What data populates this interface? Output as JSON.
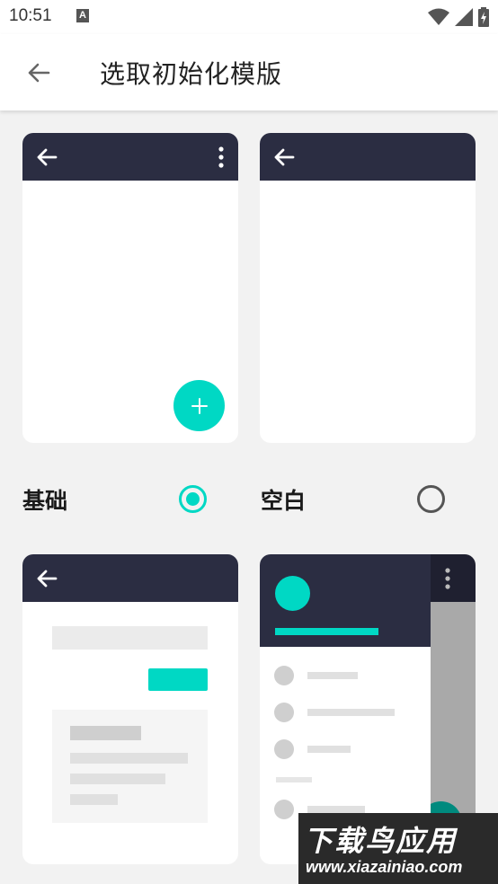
{
  "status_bar": {
    "time": "10:51",
    "notification_letter": "A",
    "icons": [
      "wifi-icon",
      "signal-icon",
      "battery-charging-icon"
    ]
  },
  "app_bar": {
    "back_icon": "arrow-left-icon",
    "title": "选取初始化模版"
  },
  "templates": [
    {
      "label": "基础",
      "selected": true
    },
    {
      "label": "空白",
      "selected": false
    },
    {
      "label": "",
      "selected": false
    },
    {
      "label": "",
      "selected": false
    }
  ],
  "watermark": {
    "main_text": "下载鸟应用",
    "sub_text": "www.xiazainiao.com"
  },
  "colors": {
    "accent": "#00d8c4",
    "toolbar_dark": "#2b2d42",
    "background": "#f2f2f2",
    "card": "#ffffff",
    "placeholder": "#d8d8d8"
  }
}
